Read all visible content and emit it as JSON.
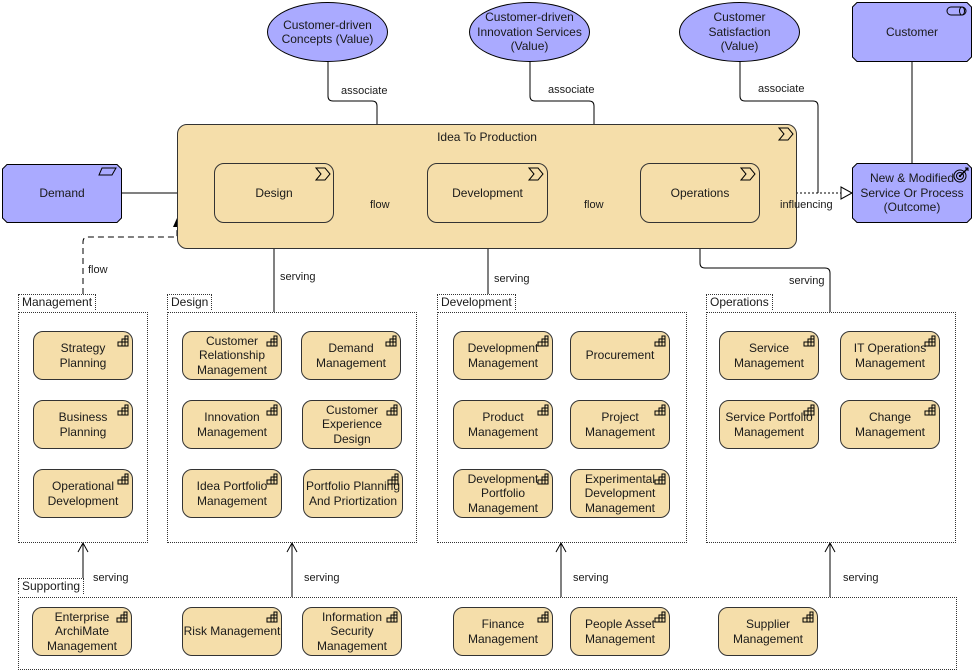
{
  "colors": {
    "value_fill": "#aaaaff",
    "business_fill": "#f5deaa",
    "stroke": "#333333"
  },
  "values": [
    {
      "id": "v1",
      "label": "Customer-driven\nConcepts (Value)"
    },
    {
      "id": "v2",
      "label": "Customer-driven\nInnovation Services\n(Value)"
    },
    {
      "id": "v3",
      "label": "Customer\nSatisfaction\n(Value)"
    }
  ],
  "customer": {
    "label": "Customer",
    "icon": "business-role-icon"
  },
  "demand": {
    "label": "Demand",
    "icon": "business-event-icon"
  },
  "outcome": {
    "label": "New & Modified\nService Or Process\n(Outcome)",
    "icon": "outcome-target-icon"
  },
  "value_stream": {
    "title": "Idea To Production",
    "icon": "value-stream-chevron-icon",
    "stages": [
      {
        "label": "Design",
        "icon": "value-stream-chevron-icon"
      },
      {
        "label": "Development",
        "icon": "value-stream-chevron-icon"
      },
      {
        "label": "Operations",
        "icon": "value-stream-chevron-icon"
      }
    ]
  },
  "relations": {
    "associate": "associate",
    "flow": "flow",
    "serving": "serving",
    "influencing": "influencing"
  },
  "groups": {
    "management": {
      "title": "Management",
      "items": [
        "Strategy\nPlanning",
        "Business\nPlanning",
        "Operational\nDevelopment"
      ]
    },
    "design": {
      "title": "Design",
      "items": [
        "Customer\nRelationship\nManagement",
        "Demand\nManagement",
        "Innovation\nManagement",
        "Customer\nExperience\nDesign",
        "Idea Portfolio\nManagement",
        "Portfolio Planning\nAnd Priortization"
      ]
    },
    "development": {
      "title": "Development",
      "items": [
        "Development\nManagement",
        "Procurement",
        "Product\nManagement",
        "Project\nManagement",
        "Development\nPortfolio\nManagement",
        "Experimental\nDevelopment\nManagement"
      ]
    },
    "operations": {
      "title": "Operations",
      "items": [
        "Service\nManagement",
        "IT Operations\nManagement",
        "Service Portfolio\nManagement",
        "Change\nManagement"
      ]
    },
    "supporting": {
      "title": "Supporting",
      "items": [
        "Enterprise\nArchiMate\nManagement",
        "Risk Management",
        "Information\nSecurity\nManagement",
        "Finance\nManagement",
        "People Asset\nManagement",
        "Supplier\nManagement"
      ]
    }
  },
  "capability_icon": "capability-icon"
}
